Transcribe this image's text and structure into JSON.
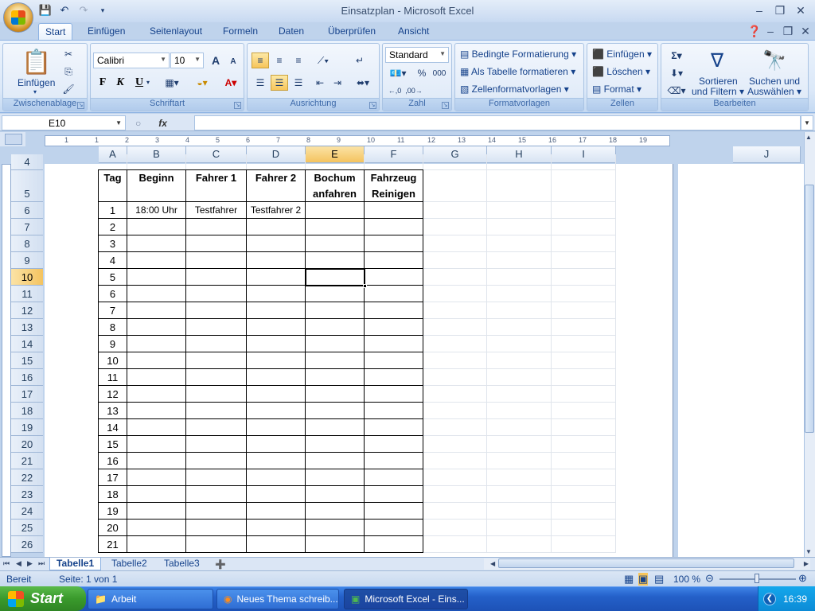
{
  "window": {
    "title": "Einsatzplan - Microsoft Excel"
  },
  "qat": {
    "save_icon": "save-icon",
    "undo_icon": "undo-icon",
    "redo_icon": "redo-icon"
  },
  "tabs": [
    "Start",
    "Einfügen",
    "Seitenlayout",
    "Formeln",
    "Daten",
    "Überprüfen",
    "Ansicht"
  ],
  "ribbon": {
    "clipboard": {
      "title": "Zwischenablage",
      "paste": "Einfügen"
    },
    "font": {
      "title": "Schriftart",
      "name": "Calibri",
      "size": "10",
      "bold": "F",
      "italic": "K",
      "underline": "U",
      "grow": "A",
      "shrink": "A"
    },
    "alignment": {
      "title": "Ausrichtung"
    },
    "number": {
      "title": "Zahl",
      "format": "Standard",
      "percent": "%",
      "thousands": "000"
    },
    "styles": {
      "title": "Formatvorlagen",
      "conditional": "Bedingte Formatierung",
      "as_table": "Als Tabelle formatieren",
      "cell_styles": "Zellenformatvorlagen"
    },
    "cells": {
      "title": "Zellen",
      "insert": "Einfügen",
      "delete": "Löschen",
      "format": "Format"
    },
    "editing": {
      "title": "Bearbeiten",
      "sort_line1": "Sortieren",
      "sort_line2": "und Filtern",
      "find_line1": "Suchen und",
      "find_line2": "Auswählen"
    }
  },
  "formula_bar": {
    "name_box": "E10",
    "fx": "fx",
    "value": ""
  },
  "ruler_ticks": [
    "1",
    "1",
    "2",
    "3",
    "4",
    "5",
    "6",
    "7",
    "8",
    "9",
    "10",
    "11",
    "12",
    "13",
    "14",
    "15",
    "16",
    "17",
    "18",
    "19"
  ],
  "columns": [
    "A",
    "B",
    "C",
    "D",
    "E",
    "F",
    "G",
    "H",
    "I"
  ],
  "column_j": "J",
  "rows": [
    "4",
    "5",
    "6",
    "7",
    "8",
    "9",
    "10",
    "11",
    "12",
    "13",
    "14",
    "15",
    "16",
    "17",
    "18",
    "19",
    "20",
    "21",
    "22",
    "23",
    "24",
    "25",
    "26"
  ],
  "selected_row": "10",
  "selected_column": "E",
  "table": {
    "headers": [
      "Tag",
      "Beginn",
      "Fahrer 1",
      "Fahrer 2",
      "Bochum anfahren",
      "Fahrzeug Reinigen"
    ],
    "rows": [
      [
        "1",
        "18:00 Uhr",
        "Testfahrer",
        "Testfahrer 2",
        "",
        ""
      ],
      [
        "2",
        "",
        "",
        "",
        "",
        ""
      ],
      [
        "3",
        "",
        "",
        "",
        "",
        ""
      ],
      [
        "4",
        "",
        "",
        "",
        "",
        ""
      ],
      [
        "5",
        "",
        "",
        "",
        "",
        ""
      ],
      [
        "6",
        "",
        "",
        "",
        "",
        ""
      ],
      [
        "7",
        "",
        "",
        "",
        "",
        ""
      ],
      [
        "8",
        "",
        "",
        "",
        "",
        ""
      ],
      [
        "9",
        "",
        "",
        "",
        "",
        ""
      ],
      [
        "10",
        "",
        "",
        "",
        "",
        ""
      ],
      [
        "11",
        "",
        "",
        "",
        "",
        ""
      ],
      [
        "12",
        "",
        "",
        "",
        "",
        ""
      ],
      [
        "13",
        "",
        "",
        "",
        "",
        ""
      ],
      [
        "14",
        "",
        "",
        "",
        "",
        ""
      ],
      [
        "15",
        "",
        "",
        "",
        "",
        ""
      ],
      [
        "16",
        "",
        "",
        "",
        "",
        ""
      ],
      [
        "17",
        "",
        "",
        "",
        "",
        ""
      ],
      [
        "18",
        "",
        "",
        "",
        "",
        ""
      ],
      [
        "19",
        "",
        "",
        "",
        "",
        ""
      ],
      [
        "20",
        "",
        "",
        "",
        "",
        ""
      ],
      [
        "21",
        "",
        "",
        "",
        "",
        ""
      ]
    ]
  },
  "sheets": [
    "Tabelle1",
    "Tabelle2",
    "Tabelle3"
  ],
  "active_sheet": "Tabelle1",
  "status": {
    "mode": "Bereit",
    "page": "Seite: 1 von 1",
    "zoom": "100 %"
  },
  "taskbar": {
    "start": "Start",
    "items": [
      "Arbeit",
      "Neues Thema schreib...",
      "Microsoft Excel - Eins..."
    ],
    "clock": "16:39"
  }
}
